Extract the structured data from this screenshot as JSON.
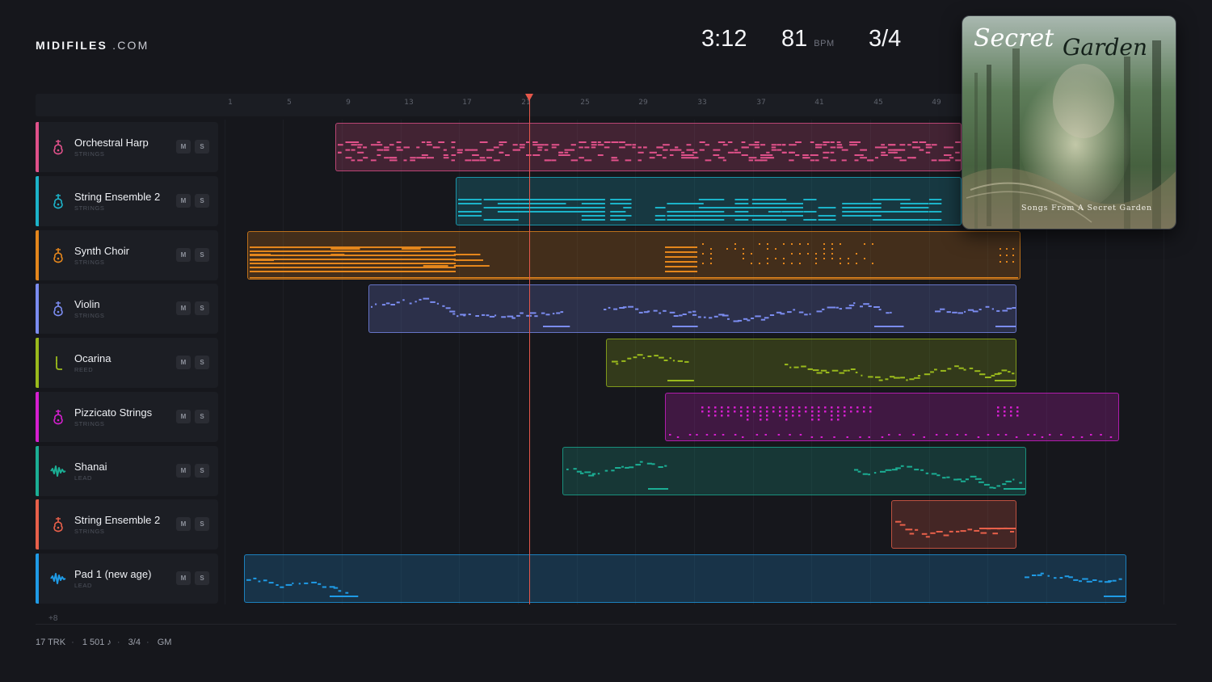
{
  "brand": {
    "name": "MIDIFILES",
    "domain": ".COM"
  },
  "header": {
    "time": "3:12",
    "bpm": "81",
    "bpm_unit": "BPM",
    "signature": "3/4"
  },
  "album": {
    "title_word1": "Secret",
    "title_word2": "Garden",
    "subtitle": "Songs From A Secret Garden"
  },
  "ruler": {
    "ticks": [
      "1",
      "5",
      "9",
      "13",
      "17",
      "21",
      "25",
      "29",
      "33",
      "37",
      "41",
      "45",
      "49"
    ]
  },
  "tracks": [
    {
      "name": "Orchestral Harp",
      "category": "STRINGS",
      "icon": "harp-icon",
      "color": "#e0518a",
      "mute": "M",
      "solo": "S"
    },
    {
      "name": "String Ensemble 2",
      "category": "STRINGS",
      "icon": "violin-icon",
      "color": "#1cb3c9",
      "mute": "M",
      "solo": "S"
    },
    {
      "name": "Synth Choir",
      "category": "STRINGS",
      "icon": "violin-icon",
      "color": "#e4861c",
      "mute": "M",
      "solo": "S"
    },
    {
      "name": "Violin",
      "category": "STRINGS",
      "icon": "violin-icon",
      "color": "#7b8cf0",
      "mute": "M",
      "solo": "S"
    },
    {
      "name": "Ocarina",
      "category": "REED",
      "icon": "reed-icon",
      "color": "#9aba1c",
      "mute": "M",
      "solo": "S"
    },
    {
      "name": "Pizzicato Strings",
      "category": "STRINGS",
      "icon": "violin-icon",
      "color": "#d51fcf",
      "mute": "M",
      "solo": "S"
    },
    {
      "name": "Shanai",
      "category": "LEAD",
      "icon": "wave-icon",
      "color": "#1bae94",
      "mute": "M",
      "solo": "S"
    },
    {
      "name": "String Ensemble 2",
      "category": "STRINGS",
      "icon": "violin-icon",
      "color": "#e8604a",
      "mute": "M",
      "solo": "S"
    },
    {
      "name": "Pad 1 (new age)",
      "category": "LEAD",
      "icon": "wave-icon",
      "color": "#1f9be6",
      "mute": "M",
      "solo": "S"
    }
  ],
  "more_tracks": "+8",
  "footer": {
    "tracks": "17 TRK",
    "notes": "1 501 ♪",
    "signature": "3/4",
    "standard": "GM"
  }
}
